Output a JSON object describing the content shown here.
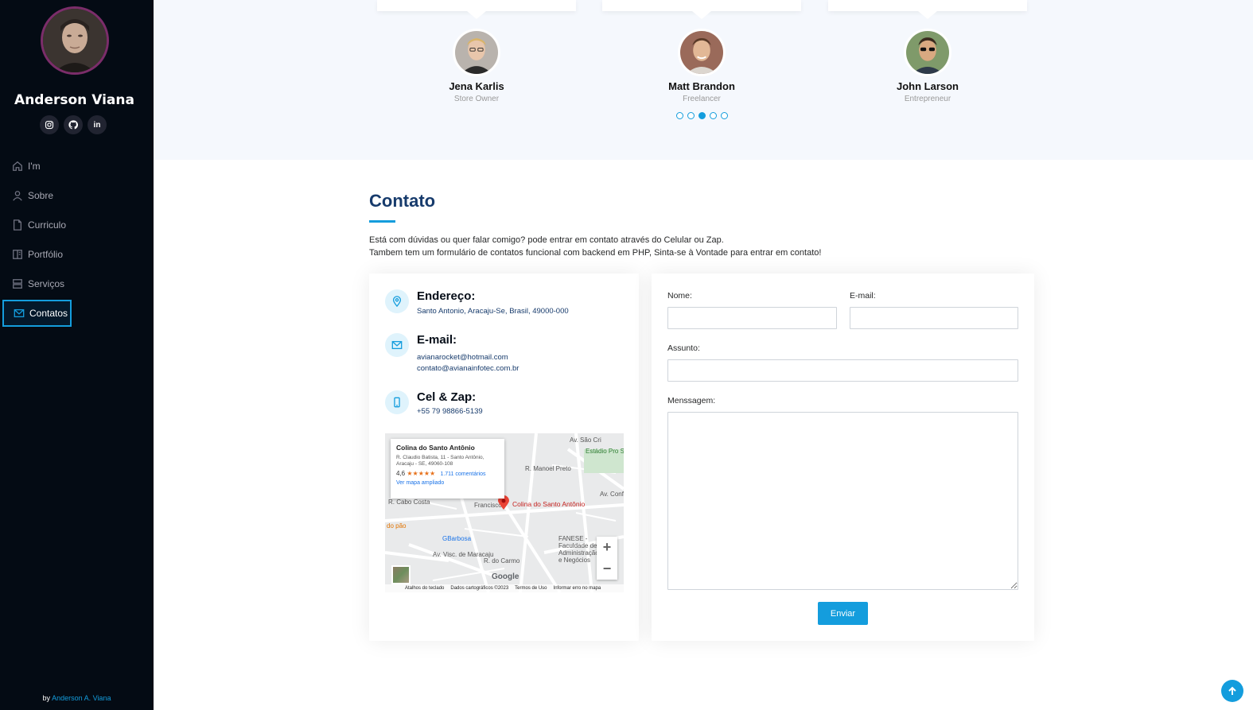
{
  "sidebar": {
    "name": "Anderson Viana",
    "social": [
      {
        "name": "instagram"
      },
      {
        "name": "github"
      },
      {
        "name": "linkedin",
        "label": "in"
      }
    ],
    "nav": [
      {
        "label": "I'm",
        "icon": "home-icon"
      },
      {
        "label": "Sobre",
        "icon": "user-icon"
      },
      {
        "label": "Curriculo",
        "icon": "file-icon"
      },
      {
        "label": "Portfólio",
        "icon": "book-icon"
      },
      {
        "label": "Serviços",
        "icon": "server-icon"
      },
      {
        "label": "Contatos",
        "icon": "envelope-icon",
        "active": true
      }
    ],
    "credit_prefix": "by",
    "credit_link": "Anderson A. Viana"
  },
  "testimonials": {
    "people": [
      {
        "name": "Jena Karlis",
        "role": "Store Owner"
      },
      {
        "name": "Matt Brandon",
        "role": "Freelancer"
      },
      {
        "name": "John Larson",
        "role": "Entrepreneur"
      }
    ],
    "pagination_count": 5,
    "active_page": 3
  },
  "contact": {
    "title": "Contato",
    "intro_line1": "Está com dúvidas ou quer falar comigo? pode entrar em contato através do Celular ou Zap.",
    "intro_line2": "Tambem tem um formulário de contatos funcional com backend em PHP, Sinta-se à Vontade para entrar em contato!",
    "address_label": "Endereço:",
    "address_value": "Santo Antonio, Aracaju-Se, Brasil, 49000-000",
    "email_label": "E-mail:",
    "email_value1": "avianarocket@hotmail.com",
    "email_value2": "contato@avianainfotec.com.br",
    "phone_label": "Cel & Zap:",
    "phone_value": "+55 79 98866-5139",
    "map": {
      "place_title": "Colina do Santo Antônio",
      "place_address": "R. Claudio Batista, 11 - Santo Antônio, Aracaju - SE, 49060-108",
      "rating": "4,6",
      "stars": "★★★★★",
      "reviews": "1.711 comentários",
      "link": "Ver mapa ampliado",
      "pin_label": "Colina do Santo Antônio",
      "labels": [
        "R. Cabo Costa",
        "do pão",
        "GBarbosa",
        "Av. Visc. de Maracaju",
        "R. do Carmo",
        "FANESE - Faculdade de Administração e Negócios",
        "Estádio Pro Sabino R",
        "Av. Confia",
        "Av. São Cri",
        "R. Manoel Preto",
        "Francisco"
      ],
      "zoom_in": "+",
      "zoom_out": "−",
      "google": "Google",
      "footer": [
        "Atalhos do teclado",
        "Dados cartográficos ©2023",
        "Termos de Uso",
        "Informar erro no mapa"
      ]
    },
    "form": {
      "name_label": "Nome:",
      "email_label": "E-mail:",
      "subject_label": "Assunto:",
      "message_label": "Menssagem:",
      "submit": "Enviar"
    }
  }
}
